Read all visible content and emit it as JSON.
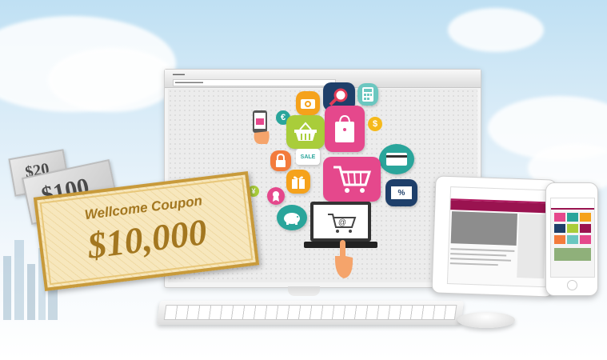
{
  "coupon": {
    "title": "Wellcome Coupon",
    "amount": "$10,000"
  },
  "notes": [
    {
      "value": "$20"
    },
    {
      "value": "$100"
    }
  ],
  "icons": {
    "euro": "€",
    "dollar": "$",
    "yen": "¥",
    "percent": "%",
    "sale": "SALE",
    "at": "@"
  },
  "colors": {
    "coupon_gold": "#a37720",
    "tablet_accent": "#9a1350",
    "sky": "#bfe0f3"
  }
}
